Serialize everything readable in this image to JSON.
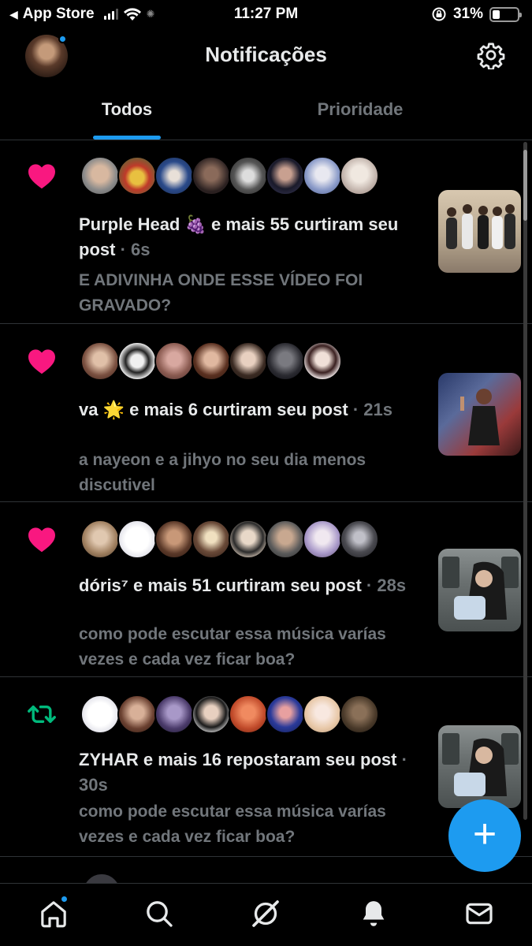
{
  "status_bar": {
    "back_app": "App Store",
    "time": "11:27 PM",
    "battery": "31%"
  },
  "header": {
    "title": "Notificações"
  },
  "tabs": [
    {
      "label": "Todos",
      "active": true
    },
    {
      "label": "Prioridade",
      "active": false
    }
  ],
  "notifications": [
    {
      "type": "like",
      "name": "Purple Head",
      "emoji": "🍇",
      "action": " e mais 55 curtiram seu post",
      "time": "6s",
      "snippet": "E ADIVINHA ONDE ESSE VÍDEO FOI GRAVADO?"
    },
    {
      "type": "like",
      "name": "va",
      "emoji": "🌟",
      "action": " e mais 6 curtiram seu post",
      "time": "21s",
      "snippet": "a nayeon e a jihyo no seu dia menos discutivel"
    },
    {
      "type": "like",
      "name": "dóris⁷",
      "emoji": "",
      "action": " e mais 51 curtiram seu post",
      "time": "28s",
      "snippet": "como pode escutar essa música varías vezes e cada vez ficar boa?"
    },
    {
      "type": "repost",
      "name": "ZYHAR",
      "emoji": "",
      "action": " e mais 16 repostaram seu post",
      "time": "30s",
      "snippet": "como pode escutar essa música varías vezes e cada vez ficar boa?"
    }
  ],
  "fab": {
    "label": "+"
  },
  "colors": {
    "accent": "#1d9bf0",
    "like": "#f91880",
    "repost": "#00ba7c",
    "secondary_text": "#71767b",
    "divider": "#2f3336"
  },
  "icons": {
    "like": "heart-icon",
    "repost": "repost-icon",
    "settings": "gear-icon",
    "nav": [
      "home-icon",
      "search-icon",
      "grok-icon",
      "bell-icon",
      "mail-icon"
    ]
  }
}
